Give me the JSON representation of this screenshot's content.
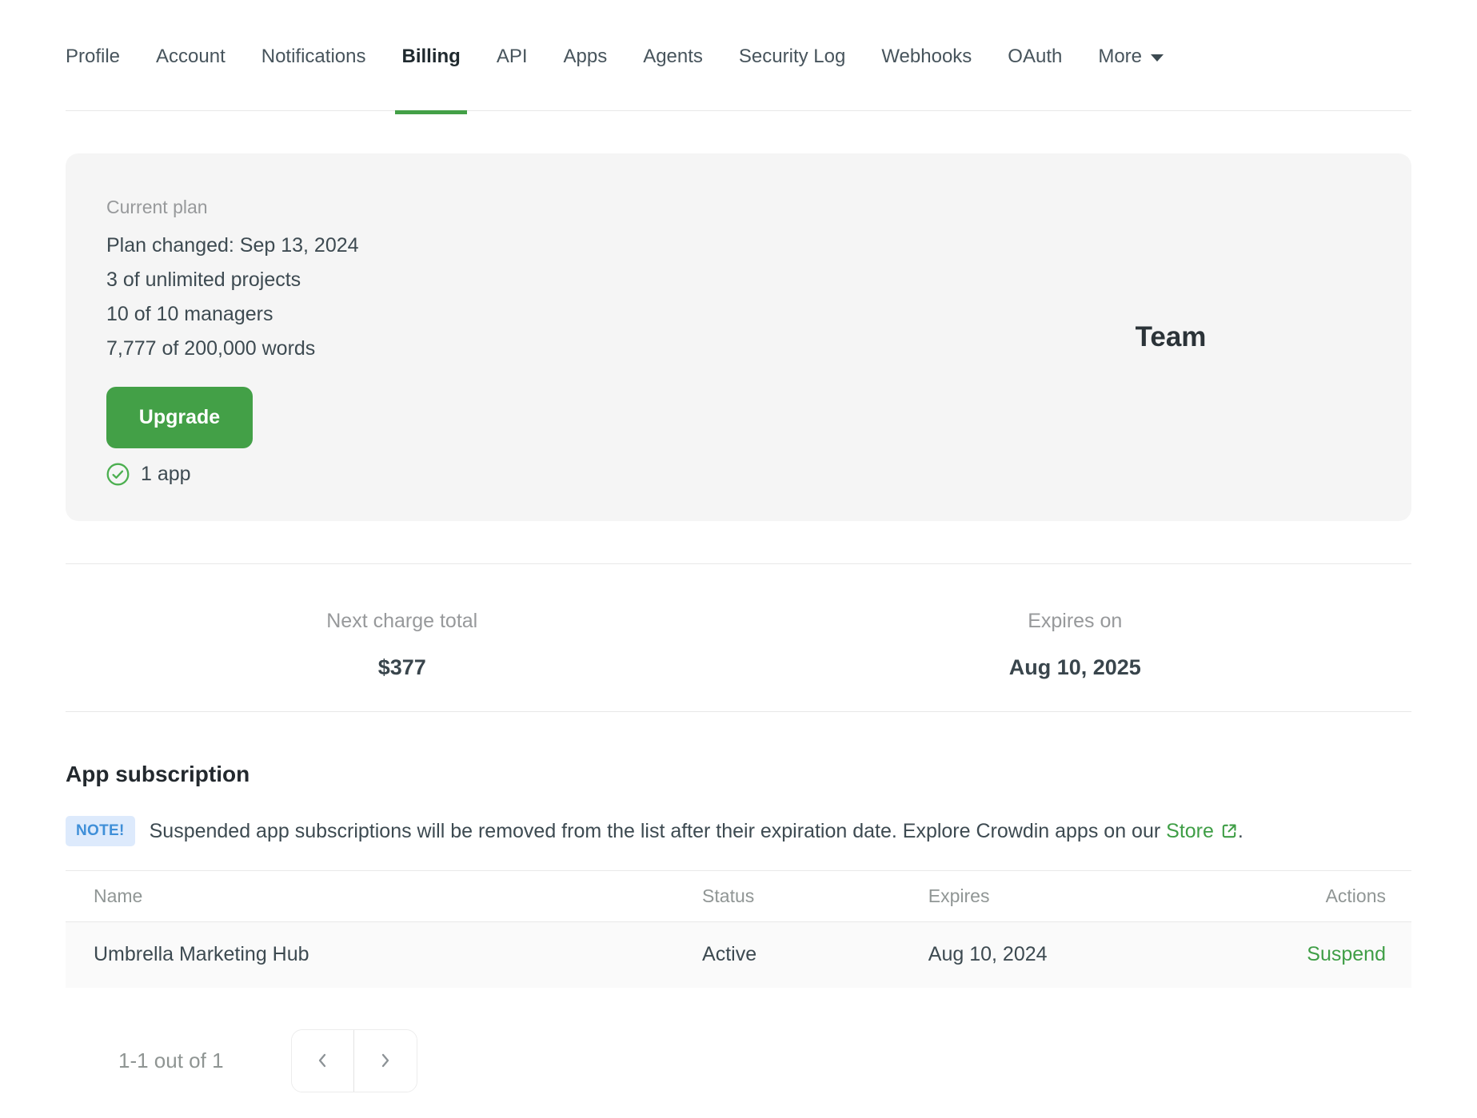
{
  "nav": {
    "tabs": [
      "Profile",
      "Account",
      "Notifications",
      "Billing",
      "API",
      "Apps",
      "Agents",
      "Security Log",
      "Webhooks",
      "OAuth"
    ],
    "active_tab": "Billing",
    "more_label": "More"
  },
  "plan_card": {
    "label": "Current plan",
    "details": [
      "Plan changed: Sep 13, 2024",
      "3 of unlimited projects",
      "10 of 10 managers",
      "7,777 of 200,000 words"
    ],
    "upgrade_label": "Upgrade",
    "apps_label": "1 app",
    "plan_name": "Team"
  },
  "billing_summary": {
    "next_charge_label": "Next charge total",
    "next_charge_value": "$377",
    "expires_label": "Expires on",
    "expires_value": "Aug 10, 2025"
  },
  "app_subscription": {
    "title": "App subscription",
    "note": {
      "badge": "NOTE!",
      "text": "Suspended app subscriptions will be removed from the list after their expiration date. Explore Crowdin apps on our",
      "store_label": "Store",
      "suffix": "."
    },
    "table": {
      "headers": [
        "Name",
        "Status",
        "Expires",
        "Actions"
      ],
      "rows": [
        {
          "name": "Umbrella Marketing Hub",
          "status": "Active",
          "expires": "Aug 10, 2024",
          "action": "Suspend"
        }
      ]
    },
    "pagination": {
      "summary": "1-1 out of 1"
    }
  },
  "icons": {
    "chevron-down-icon": "▾",
    "check-circle-icon": "✓",
    "external-link-icon": "↗",
    "chevron-left-icon": "‹",
    "chevron-right-icon": "›"
  },
  "colors": {
    "accent_green": "#43a047",
    "link_green": "#3f9e46",
    "note_badge_bg": "#ddeafc",
    "note_badge_text": "#3f8fd8",
    "card_bg": "#f5f5f5",
    "row_bg": "#fafafa",
    "divider": "#e8e8e8"
  }
}
